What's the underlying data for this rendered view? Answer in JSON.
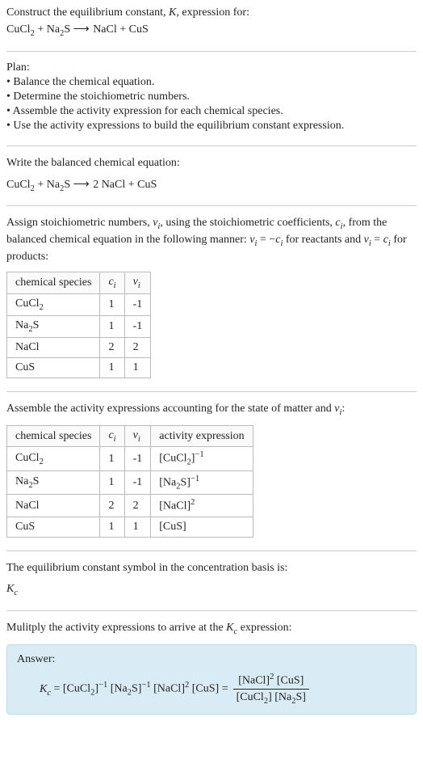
{
  "header": {
    "prompt": "Construct the equilibrium constant, K, expression for:",
    "equation": "CuCl₂ + Na₂S ⟶ NaCl + CuS"
  },
  "plan": {
    "heading": "Plan:",
    "items": [
      "• Balance the chemical equation.",
      "• Determine the stoichiometric numbers.",
      "• Assemble the activity expression for each chemical species.",
      "• Use the activity expressions to build the equilibrium constant expression."
    ]
  },
  "balanced": {
    "text": "Write the balanced chemical equation:",
    "equation": "CuCl₂ + Na₂S ⟶ 2 NaCl + CuS"
  },
  "assign": {
    "text": "Assign stoichiometric numbers, νᵢ, using the stoichiometric coefficients, cᵢ, from the balanced chemical equation in the following manner: νᵢ = −cᵢ for reactants and νᵢ = cᵢ for products:"
  },
  "table1": {
    "headers": [
      "chemical species",
      "cᵢ",
      "νᵢ"
    ],
    "rows": [
      {
        "species": "CuCl₂",
        "c": "1",
        "v": "-1"
      },
      {
        "species": "Na₂S",
        "c": "1",
        "v": "-1"
      },
      {
        "species": "NaCl",
        "c": "2",
        "v": "2"
      },
      {
        "species": "CuS",
        "c": "1",
        "v": "1"
      }
    ]
  },
  "assemble": {
    "text": "Assemble the activity expressions accounting for the state of matter and νᵢ:"
  },
  "table2": {
    "headers": [
      "chemical species",
      "cᵢ",
      "νᵢ",
      "activity expression"
    ],
    "rows": [
      {
        "species": "CuCl₂",
        "c": "1",
        "v": "-1",
        "act": "[CuCl₂]⁻¹"
      },
      {
        "species": "Na₂S",
        "c": "1",
        "v": "-1",
        "act": "[Na₂S]⁻¹"
      },
      {
        "species": "NaCl",
        "c": "2",
        "v": "2",
        "act": "[NaCl]²"
      },
      {
        "species": "CuS",
        "c": "1",
        "v": "1",
        "act": "[CuS]"
      }
    ]
  },
  "symbol": {
    "text": "The equilibrium constant symbol in the concentration basis is:",
    "value": "K_c"
  },
  "multiply": {
    "text": "Mulitply the activity expressions to arrive at the K_c expression:"
  },
  "answer": {
    "label": "Answer:",
    "lhs": "K_c =",
    "flat": "[CuCl₂]⁻¹ [Na₂S]⁻¹ [NaCl]² [CuS] =",
    "num": "[NaCl]² [CuS]",
    "den": "[CuCl₂] [Na₂S]"
  }
}
